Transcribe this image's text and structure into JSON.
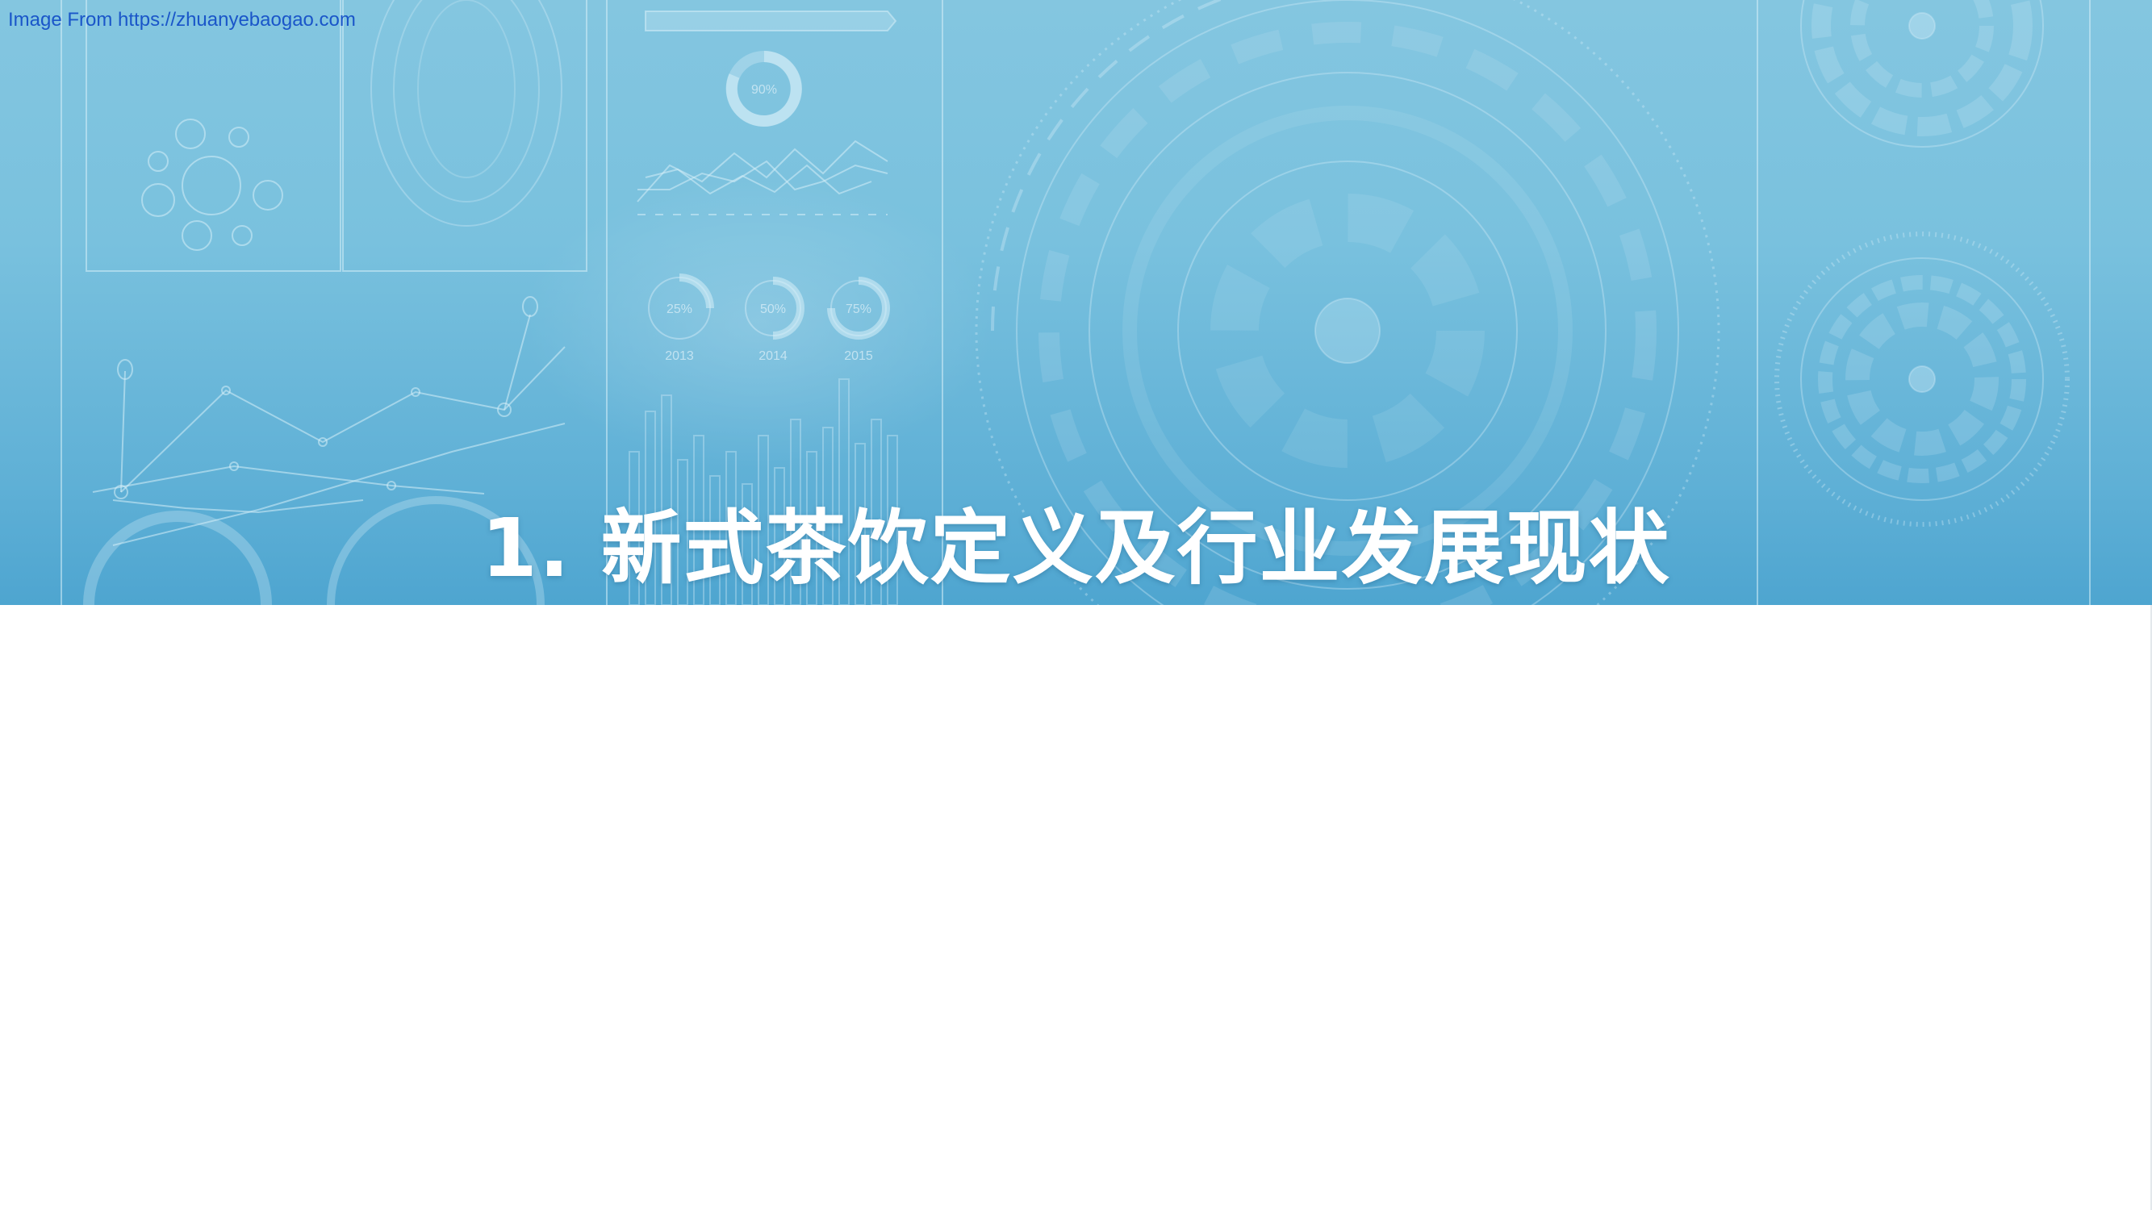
{
  "banner": {
    "source_text": "Image From https://zhuanyebaogao.com",
    "title": "1. 新式茶饮定义及行业发展现状",
    "decor": {
      "donut_top_label": "90%",
      "ring_labels": [
        "25%",
        "50%",
        "75%"
      ],
      "year_labels": [
        "2013",
        "2014",
        "2015"
      ]
    }
  },
  "colors": {
    "banner_top": "#84c6e0",
    "banner_bottom": "#4ea5d0",
    "title": "#ffffff",
    "link": "#1a56c9",
    "decor_line": "#d6eef8"
  }
}
